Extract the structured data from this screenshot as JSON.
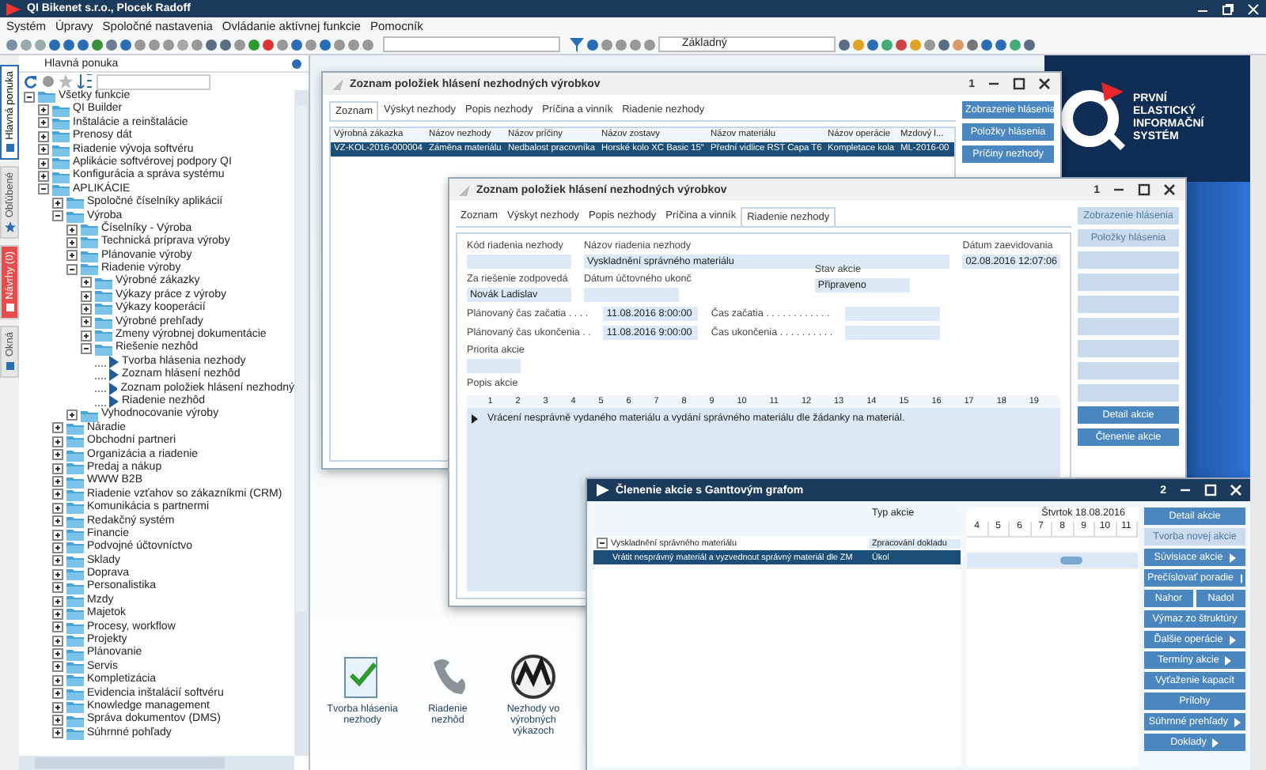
{
  "window": {
    "title": "QI Bikenet s.r.o., Plocek Radoff"
  },
  "menu": [
    "Systém",
    "Úpravy",
    "Spoločné nastavenia",
    "Ovládanie aktívnej funkcie",
    "Pomocník"
  ],
  "toolbar": {
    "profile": "Základný"
  },
  "side_tabs": [
    {
      "label": "Hlavná ponuka",
      "selected": true,
      "kind": "menu"
    },
    {
      "label": "Obľúbené",
      "selected": false,
      "kind": "star"
    },
    {
      "label": "Návrhy (0)",
      "selected": false,
      "kind": "alert"
    },
    {
      "label": "Okná",
      "selected": false,
      "kind": "windows"
    }
  ],
  "sidebar": {
    "title": "Hlavná ponuka",
    "tree": [
      {
        "label": "Všetky funkcie",
        "kind": "folder",
        "expanded": true,
        "children": [
          {
            "label": "QI Builder",
            "kind": "folder",
            "expanded": false
          },
          {
            "label": "Inštalácie a reinštalácie",
            "kind": "folder",
            "expanded": false
          },
          {
            "label": "Prenosy dát",
            "kind": "folder",
            "expanded": false
          },
          {
            "label": "Riadenie vývoja softvéru",
            "kind": "folder",
            "expanded": false
          },
          {
            "label": "Aplikácie softvérovej podpory QI",
            "kind": "folder",
            "expanded": false
          },
          {
            "label": "Konfigurácia a správa systému",
            "kind": "folder",
            "expanded": false
          },
          {
            "label": "APLIKÁCIE",
            "kind": "folder",
            "expanded": true,
            "children": [
              {
                "label": "Spoločné číselníky aplikácií",
                "kind": "folder",
                "expanded": false
              },
              {
                "label": "Výroba",
                "kind": "folder",
                "expanded": true,
                "children": [
                  {
                    "label": "Číselníky - Výroba",
                    "kind": "folder",
                    "expanded": false
                  },
                  {
                    "label": "Technická príprava výroby",
                    "kind": "folder",
                    "expanded": false
                  },
                  {
                    "label": "Plánovanie výroby",
                    "kind": "folder",
                    "expanded": false
                  },
                  {
                    "label": "Riadenie výroby",
                    "kind": "folder",
                    "expanded": true,
                    "children": [
                      {
                        "label": "Výrobné zákazky",
                        "kind": "folder",
                        "expanded": false
                      },
                      {
                        "label": "Výkazy práce z výroby",
                        "kind": "folder",
                        "expanded": false
                      },
                      {
                        "label": "Výkazy kooperácií",
                        "kind": "folder",
                        "expanded": false
                      },
                      {
                        "label": "Výrobné prehľady",
                        "kind": "folder",
                        "expanded": false
                      },
                      {
                        "label": "Zmeny výrobnej dokumentácie",
                        "kind": "folder",
                        "expanded": false
                      },
                      {
                        "label": "Riešenie nezhôd",
                        "kind": "folder",
                        "expanded": true,
                        "children": [
                          {
                            "label": "Tvorba hlásenia nezhody",
                            "kind": "leaf"
                          },
                          {
                            "label": "Zoznam hlásení nezhôd",
                            "kind": "leaf"
                          },
                          {
                            "label": "Zoznam položiek hlásení nezhodný",
                            "kind": "leaf"
                          },
                          {
                            "label": "Riadenie nezhôd",
                            "kind": "leaf"
                          }
                        ]
                      }
                    ]
                  },
                  {
                    "label": "Vyhodnocovanie výroby",
                    "kind": "folder",
                    "expanded": false
                  }
                ]
              },
              {
                "label": "Náradie",
                "kind": "folder",
                "expanded": false
              },
              {
                "label": "Obchodní partneri",
                "kind": "folder",
                "expanded": false
              },
              {
                "label": "Organizácia a riadenie",
                "kind": "folder",
                "expanded": false
              },
              {
                "label": "Predaj a nákup",
                "kind": "folder",
                "expanded": false
              },
              {
                "label": "WWW B2B",
                "kind": "folder",
                "expanded": false
              },
              {
                "label": "Riadenie vzťahov so zákazníkmi (CRM)",
                "kind": "folder",
                "expanded": false
              },
              {
                "label": "Komunikácia s partnermi",
                "kind": "folder",
                "expanded": false
              },
              {
                "label": "Redakčný systém",
                "kind": "folder",
                "expanded": false
              },
              {
                "label": "Financie",
                "kind": "folder",
                "expanded": false
              },
              {
                "label": "Podvojné účtovníctvo",
                "kind": "folder",
                "expanded": false
              },
              {
                "label": "Sklady",
                "kind": "folder",
                "expanded": false
              },
              {
                "label": "Doprava",
                "kind": "folder",
                "expanded": false
              },
              {
                "label": "Personalistika",
                "kind": "folder",
                "expanded": false
              },
              {
                "label": "Mzdy",
                "kind": "folder",
                "expanded": false
              },
              {
                "label": "Majetok",
                "kind": "folder",
                "expanded": false
              },
              {
                "label": "Procesy, workflow",
                "kind": "folder",
                "expanded": false
              },
              {
                "label": "Projekty",
                "kind": "folder",
                "expanded": false
              },
              {
                "label": "Plánovanie",
                "kind": "folder",
                "expanded": false
              },
              {
                "label": "Servis",
                "kind": "folder",
                "expanded": false
              },
              {
                "label": "Kompletizácia",
                "kind": "folder",
                "expanded": false
              },
              {
                "label": "Evidencia inštalácií softvéru",
                "kind": "folder",
                "expanded": false
              },
              {
                "label": "Knowledge management",
                "kind": "folder",
                "expanded": false
              },
              {
                "label": "Správa dokumentov (DMS)",
                "kind": "folder",
                "expanded": false
              },
              {
                "label": "Súhrnné pohľady",
                "kind": "folder",
                "expanded": false
              }
            ]
          }
        ]
      }
    ]
  },
  "logo": {
    "text": "PRVNÍ ELASTICKÝ INFORMAČNÍ SYSTÉM"
  },
  "list_window": {
    "title": "Zoznam položiek hlásení nezhodných výrobkov",
    "number": "1",
    "tabs": [
      {
        "label": "Zoznam",
        "selected": true
      },
      {
        "label": "Výskyt nezhody",
        "selected": false
      },
      {
        "label": "Popis nezhody",
        "selected": false
      },
      {
        "label": "Príčina a vinník",
        "selected": false
      },
      {
        "label": "Riadenie nezhody",
        "selected": false
      }
    ],
    "columns": [
      "Výrobná zákazka",
      "Názov nezhody",
      "Názov príčiny",
      "Názov zostavy",
      "Názov materiálu",
      "Názov operácie",
      "Mzdový l..."
    ],
    "rows": [
      {
        "selected": true,
        "cells": [
          "VZ-KOL-2016-000004",
          "Záměna materiálu",
          "Nedbalost pracovníka",
          "Horské kolo XC Basic 15\"",
          "Přední vidlice RST Capa T6",
          "Kompletace kola",
          "ML-2016-00"
        ]
      }
    ],
    "buttons": [
      {
        "label": "Zobrazenie hlásenia",
        "disabled": false
      },
      {
        "label": "Položky hlásenia",
        "disabled": false
      },
      {
        "label": "Príčiny nezhody",
        "disabled": false
      }
    ]
  },
  "detail_window": {
    "title": "Zoznam položiek hlásení nezhodných výrobkov",
    "number": "1",
    "tabs": [
      {
        "label": "Zoznam",
        "selected": false
      },
      {
        "label": "Výskyt nezhody",
        "selected": false
      },
      {
        "label": "Popis nezhody",
        "selected": false
      },
      {
        "label": "Príčina a vinník",
        "selected": false
      },
      {
        "label": "Riadenie nezhody",
        "selected": true
      }
    ],
    "fields": {
      "code": {
        "label": "Kód riadenia nezhody"
      },
      "name": {
        "label": "Názov riadenia nezhody",
        "value": "Vyskladnění správného materiálu"
      },
      "date": {
        "label": "Dátum zaevidovania",
        "value": "02.08.2016 12:07:06"
      },
      "responsible": {
        "label": "Za riešenie zodpovedá",
        "value": "Novák Ladislav"
      },
      "account_date": {
        "label": "Dátum účtovného ukonč"
      },
      "state": {
        "label": "Stav akcie",
        "value": "Připraveno"
      },
      "planned_start": {
        "label": "Plánovaný čas začatia . . . .",
        "value": "11.08.2016 8:00:00"
      },
      "start": {
        "label": "Čas začatia . . . . . . . . . . . ."
      },
      "planned_end": {
        "label": "Plánovaný čas ukončenia . .",
        "value": "11.08.2016 9:00:00"
      },
      "end": {
        "label": "Čas ukončenia . . . . . . . . . ."
      },
      "priority": {
        "label": "Priorita akcie"
      },
      "description": {
        "label": "Popis akcie",
        "value": "Vrácení nesprávně vydaného materiálu a vydání správného materiálu dle žádanky na materiál."
      }
    },
    "ruler": [
      "1",
      "2",
      "3",
      "4",
      "5",
      "6",
      "7",
      "8",
      "9",
      "10",
      "11",
      "12",
      "13",
      "14",
      "15",
      "16",
      "17",
      "18",
      "19"
    ],
    "buttons": [
      {
        "label": "Zobrazenie hlásenia",
        "disabled": true
      },
      {
        "label": "Položky hlásenia",
        "disabled": true
      },
      {
        "disabled": true
      },
      {
        "disabled": true
      },
      {
        "disabled": true
      },
      {
        "disabled": true
      },
      {
        "disabled": true
      },
      {
        "disabled": true
      },
      {
        "disabled": true
      },
      {
        "label": "Detail akcie",
        "disabled": false
      },
      {
        "label": "Členenie akcie",
        "disabled": false
      }
    ]
  },
  "gantt_window": {
    "title": "Členenie akcie s Ganttovým grafom",
    "number": "2",
    "active": true,
    "type_header": "Typ akcie",
    "rows": [
      {
        "label": "Vyskladnění správného materiálu",
        "type": "Zpracování dokladu",
        "selected": false,
        "expanded": true,
        "children": [
          {
            "label": "Vrátit nesprávný materiál a vyzvednout správný materiál dle ZM",
            "type": "Úkol",
            "selected": true
          }
        ]
      }
    ],
    "date_header": "Štvrtok 18.08.2016",
    "days": [
      "4",
      "5",
      "6",
      "7",
      "8",
      "9",
      "10",
      "11"
    ],
    "buttons": [
      {
        "label": "Detail akcie",
        "disabled": false,
        "kind": "plain"
      },
      {
        "label": "Tvorba novej akcie",
        "disabled": true,
        "kind": "plain"
      },
      {
        "label": "Súvisiace akcie",
        "disabled": false,
        "kind": "submenu"
      },
      {
        "label": "Prečíslovať poradie",
        "disabled": false,
        "kind": "submenu"
      },
      {
        "label": "Nahor",
        "disabled": false,
        "kind": "half"
      },
      {
        "label": "Nadol",
        "disabled": false,
        "kind": "half"
      },
      {
        "label": "Výmaz zo štruktúry",
        "disabled": false,
        "kind": "plain"
      },
      {
        "label": "Ďalšie operácie",
        "disabled": false,
        "kind": "submenu"
      },
      {
        "label": "Termíny akcie",
        "disabled": false,
        "kind": "submenu"
      },
      {
        "label": "Vyťaženie kapacít",
        "disabled": false,
        "kind": "plain"
      },
      {
        "label": "Prílohy",
        "disabled": false,
        "kind": "plain"
      },
      {
        "label": "Súhrnné prehľady",
        "disabled": false,
        "kind": "submenu"
      },
      {
        "label": "Doklady",
        "disabled": false,
        "kind": "submenu"
      }
    ]
  },
  "desktop_icons": [
    {
      "label": "Tvorba hlásenia nezhody",
      "kind": "report"
    },
    {
      "label": "Riadenie nezhôd",
      "kind": "phone"
    },
    {
      "label": "Nezhody vo výrobných výkazoch",
      "kind": "chart"
    }
  ]
}
